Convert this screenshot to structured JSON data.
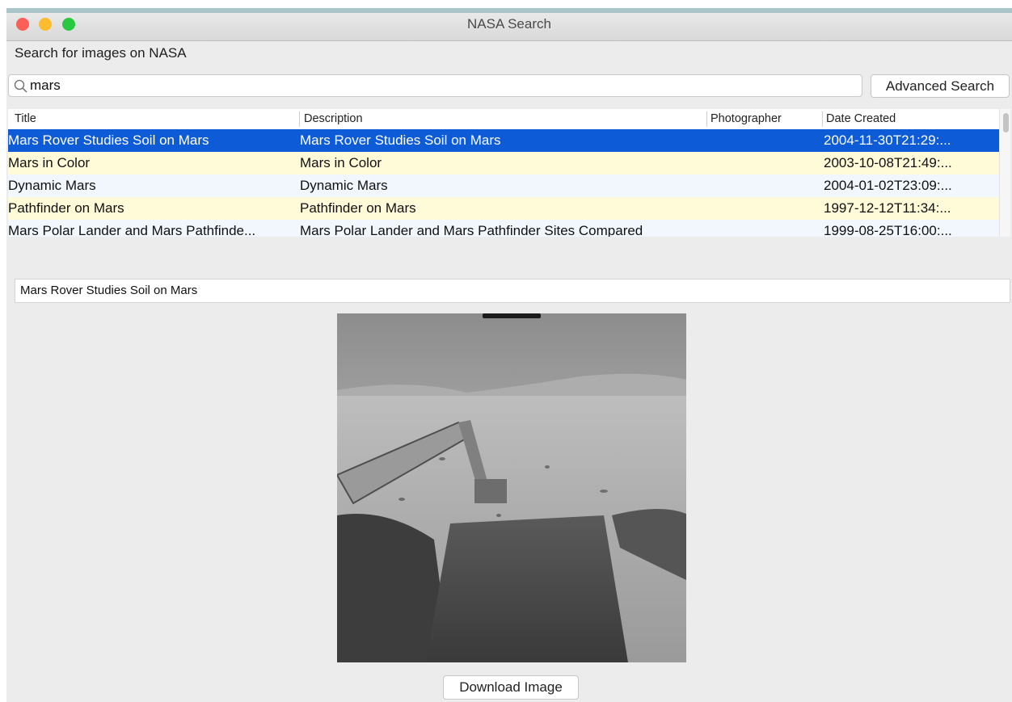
{
  "window": {
    "title": "NASA Search"
  },
  "header": {
    "subtitle": "Search for images on NASA"
  },
  "search": {
    "value": "mars",
    "advanced_button": "Advanced Search"
  },
  "table": {
    "columns": [
      "Title",
      "Description",
      "Photographer",
      "Date Created"
    ],
    "rows": [
      {
        "title": "Mars Rover Studies Soil on Mars",
        "description": "Mars Rover Studies Soil on Mars",
        "photographer": "",
        "date": "2004-11-30T21:29:..."
      },
      {
        "title": "Mars in Color",
        "description": "Mars in Color",
        "photographer": "",
        "date": "2003-10-08T21:49:..."
      },
      {
        "title": "Dynamic Mars",
        "description": "Dynamic Mars",
        "photographer": "",
        "date": "2004-01-02T23:09:..."
      },
      {
        "title": "Pathfinder on Mars",
        "description": "Pathfinder on Mars",
        "photographer": "",
        "date": "1997-12-12T11:34:..."
      },
      {
        "title": "Mars Polar Lander and Mars Pathfinde...",
        "description": "Mars Polar Lander and Mars Pathfinder Sites Compared",
        "photographer": "",
        "date": "1999-08-25T16:00:..."
      }
    ],
    "selected_index": 0
  },
  "detail": {
    "caption": "Mars Rover Studies Soil on Mars"
  },
  "actions": {
    "download_label": "Download Image"
  },
  "colors": {
    "selection": "#0d5bd6",
    "row_alt": "#fffad8",
    "row_base": "#f2f7fd"
  },
  "icons": {
    "search": "search-icon"
  }
}
